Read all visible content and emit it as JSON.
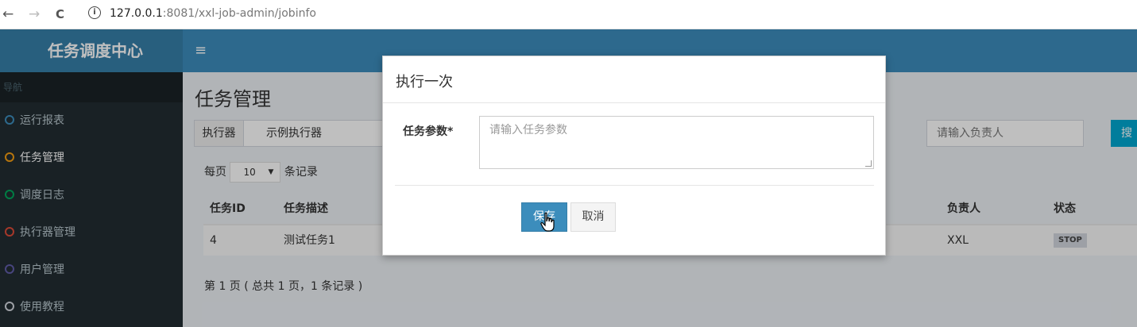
{
  "browser": {
    "back": "←",
    "forward": "→",
    "reload": "C",
    "info": "i",
    "url_host": "127.0.0.1",
    "url_rest": ":8081/xxl-job-admin/jobinfo"
  },
  "header": {
    "logo": "任务调度中心",
    "menu_toggle": "≡"
  },
  "sidebar": {
    "header": "导航",
    "items": [
      {
        "label": "运行报表",
        "color": "#3c8dbc"
      },
      {
        "label": "任务管理",
        "color": "#f39c12"
      },
      {
        "label": "调度日志",
        "color": "#00a65a"
      },
      {
        "label": "执行器管理",
        "color": "#dd4b39"
      },
      {
        "label": "用户管理",
        "color": "#605ca8"
      },
      {
        "label": "使用教程",
        "color": "#d2d6de"
      }
    ]
  },
  "content": {
    "title": "任务管理",
    "filter": {
      "executor_label": "执行器",
      "executor_value": "示例执行器",
      "owner_placeholder": "请输入负责人",
      "search_label": "搜"
    },
    "perpage": {
      "prefix": "每页",
      "value": "10",
      "arrow": "▼",
      "suffix": "条记录"
    },
    "table": {
      "headers": {
        "id": "任务ID",
        "desc": "任务描述",
        "owner": "负责人",
        "status": "状态"
      },
      "row": {
        "id": "4",
        "desc": "测试任务1",
        "owner": "XXL",
        "status": "STOP"
      }
    },
    "page_info": "第 1 页 ( 总共 1 页，1 条记录 )"
  },
  "modal": {
    "title": "执行一次",
    "param_label": "任务参数*",
    "param_placeholder": "请输入任务参数",
    "save_label": "保存",
    "cancel_label": "取消"
  }
}
